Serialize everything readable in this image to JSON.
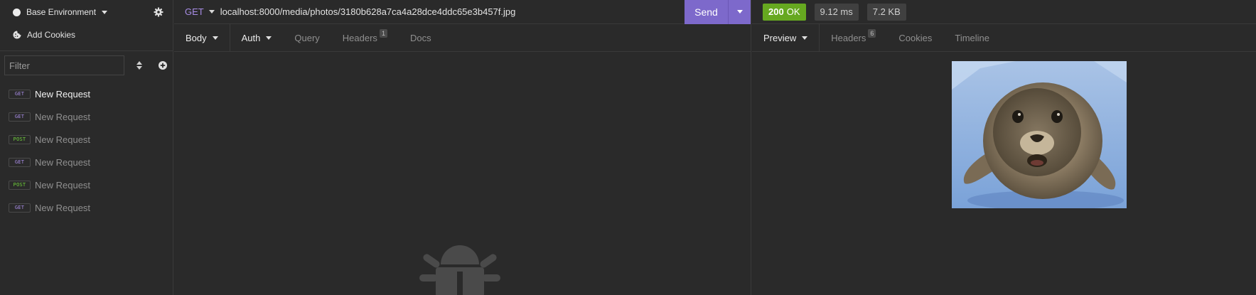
{
  "sidebar": {
    "environment": "Base Environment",
    "add_cookies": "Add Cookies",
    "filter_placeholder": "Filter",
    "requests": [
      {
        "method": "GET",
        "name": "New Request",
        "active": true
      },
      {
        "method": "GET",
        "name": "New Request"
      },
      {
        "method": "POST",
        "name": "New Request"
      },
      {
        "method": "GET",
        "name": "New Request"
      },
      {
        "method": "POST",
        "name": "New Request"
      },
      {
        "method": "GET",
        "name": "New Request"
      }
    ]
  },
  "request": {
    "method": "GET",
    "url": "localhost:8000/media/photos/3180b628a7ca4a28dce4ddc65e3b457f.jpg",
    "send_label": "Send",
    "tabs": {
      "body": "Body",
      "auth": "Auth",
      "query": "Query",
      "headers": "Headers",
      "headers_count": "1",
      "docs": "Docs"
    }
  },
  "response": {
    "status_code": "200",
    "status_text": "OK",
    "time": "9.12 ms",
    "size": "7.2 KB",
    "tabs": {
      "preview": "Preview",
      "headers": "Headers",
      "headers_count": "6",
      "cookies": "Cookies",
      "timeline": "Timeline"
    }
  },
  "icons": {
    "environment": "circle-icon",
    "settings": "gear-icon",
    "cookies": "cookie-icon",
    "sort": "sort-icon",
    "add": "plus-circle-icon",
    "empty_state": "bug-icon"
  },
  "colors": {
    "accent": "#7d69cb",
    "get": "#a88de6",
    "post": "#6fcf3a",
    "ok": "#66a820",
    "background": "#2a2a2a"
  }
}
